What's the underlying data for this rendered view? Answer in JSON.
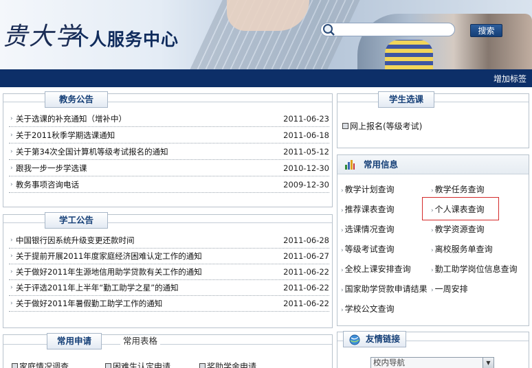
{
  "header": {
    "logo_script": "贵大学",
    "title": "个人服务中心",
    "search": {
      "value": "",
      "placeholder": ""
    },
    "search_button": "搜索"
  },
  "navbar": {
    "add_tag": "增加标签"
  },
  "academic_notices": {
    "tab": "教务公告",
    "items": [
      {
        "title": "关于选课的补充通知（增补中）",
        "date": "2011-06-23"
      },
      {
        "title": "关于2011秋季学期选课通知",
        "date": "2011-06-18"
      },
      {
        "title": "关于第34次全国计算机等级考试报名的通知",
        "date": "2011-05-12"
      },
      {
        "title": "跟我一步一步学选课",
        "date": "2010-12-30"
      },
      {
        "title": "教务事项咨询电话",
        "date": "2009-12-30"
      }
    ]
  },
  "student_affairs_notices": {
    "tab": "学工公告",
    "items": [
      {
        "title": "中国银行因系统升级变更还款时间",
        "date": "2011-06-28"
      },
      {
        "title": "关于提前开展2011年度家庭经济困难认定工作的通知",
        "date": "2011-06-27"
      },
      {
        "title": "关于做好2011年生源地信用助学贷款有关工作的通知",
        "date": "2011-06-22"
      },
      {
        "title": "关于评选2011年上半年“勤工助学之星”的通知",
        "date": "2011-06-22"
      },
      {
        "title": "关于做好2011年暑假勤工助学工作的通知",
        "date": "2011-06-22"
      }
    ]
  },
  "applications": {
    "tab_active": "常用申请",
    "tab_inactive": "常用表格",
    "items": [
      "家庭情况调查",
      "困难生认定申请",
      "奖助学金申请"
    ]
  },
  "course_selection": {
    "tab": "学生选课",
    "link": "网上报名(等级考试)"
  },
  "common_info": {
    "title": "常用信息",
    "links": [
      "教学计划查询",
      "教学任务查询",
      "推荐课表查询",
      "个人课表查询",
      "选课情况查询",
      "教学资源查询",
      "等级考试查询",
      "离校服务单查询",
      "全校上课安排查询",
      "勤工助学岗位信息查询",
      "国家助学贷款申请结果",
      "一周安排",
      "学校公文查询"
    ]
  },
  "friend_links": {
    "title": "友情链接",
    "select_value": "校内导航"
  }
}
